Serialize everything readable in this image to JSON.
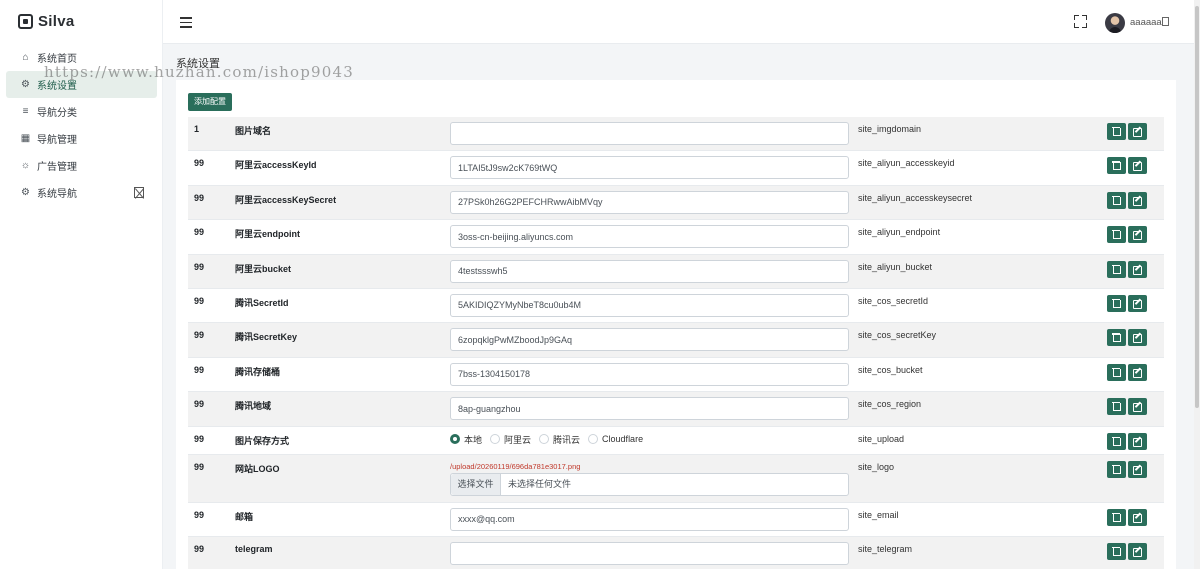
{
  "brand": {
    "name": "Silva"
  },
  "sidebar": {
    "items": [
      {
        "label": "系统首页",
        "icon": "home-icon",
        "glyph": "⌂",
        "active": false
      },
      {
        "label": "系统设置",
        "icon": "gear-icon",
        "glyph": "⚙",
        "active": true
      },
      {
        "label": "导航分类",
        "icon": "list-icon",
        "glyph": "≡",
        "active": false
      },
      {
        "label": "导航管理",
        "icon": "grid-icon",
        "glyph": "▦",
        "active": false
      },
      {
        "label": "广告管理",
        "icon": "sun-icon",
        "glyph": "☼",
        "active": false
      },
      {
        "label": "系统导航",
        "icon": "gear-icon",
        "glyph": "⚙",
        "active": false,
        "caret": true
      }
    ]
  },
  "header": {
    "username": "aaaaaa"
  },
  "watermark": "https://www.huzhan.com/ishop9043",
  "main": {
    "title": "系统设置",
    "add_label": "添加配置",
    "rows": [
      {
        "id": "1",
        "name": "图片域名",
        "type": "text",
        "value": "",
        "key": "site_imgdomain"
      },
      {
        "id": "99",
        "name": "阿里云accessKeyId",
        "type": "text",
        "value": "1LTAI5tJ9sw2cK769tWQ",
        "key": "site_aliyun_accesskeyid"
      },
      {
        "id": "99",
        "name": "阿里云accessKeySecret",
        "type": "text",
        "value": "27PSk0h26G2PEFCHRwwAibMVqy",
        "key": "site_aliyun_accesskeysecret"
      },
      {
        "id": "99",
        "name": "阿里云endpoint",
        "type": "text",
        "value": "3oss-cn-beijing.aliyuncs.com",
        "key": "site_aliyun_endpoint"
      },
      {
        "id": "99",
        "name": "阿里云bucket",
        "type": "text",
        "value": "4testssswh5",
        "key": "site_aliyun_bucket"
      },
      {
        "id": "99",
        "name": "腾讯SecretId",
        "type": "text",
        "value": "5AKIDIQZYMyNbeT8cu0ub4M",
        "key": "site_cos_secretId"
      },
      {
        "id": "99",
        "name": "腾讯SecretKey",
        "type": "text",
        "value": "6zopqklgPwMZboodJp9GAq",
        "key": "site_cos_secretKey"
      },
      {
        "id": "99",
        "name": "腾讯存储桶",
        "type": "text",
        "value": "7bss-1304150178",
        "key": "site_cos_bucket"
      },
      {
        "id": "99",
        "name": "腾讯地域",
        "type": "text",
        "value": "8ap-guangzhou",
        "key": "site_cos_region"
      },
      {
        "id": "99",
        "name": "图片保存方式",
        "type": "radio",
        "options": [
          "本地",
          "阿里云",
          "腾讯云",
          "Cloudflare"
        ],
        "selected": 0,
        "key": "site_upload"
      },
      {
        "id": "99",
        "name": "网站LOGO",
        "type": "file",
        "path": "/upload/20260119/696da781e3017.png",
        "file_button": "选择文件",
        "file_status": "未选择任何文件",
        "key": "site_logo"
      },
      {
        "id": "99",
        "name": "邮箱",
        "type": "text",
        "value": "xxxx@qq.com",
        "key": "site_email"
      },
      {
        "id": "99",
        "name": "telegram",
        "type": "text",
        "value": "",
        "key": "site_telegram"
      }
    ]
  },
  "colors": {
    "primary": "#2a6e5b",
    "active_bg": "#e6eeea",
    "path_red": "#c0392b"
  }
}
